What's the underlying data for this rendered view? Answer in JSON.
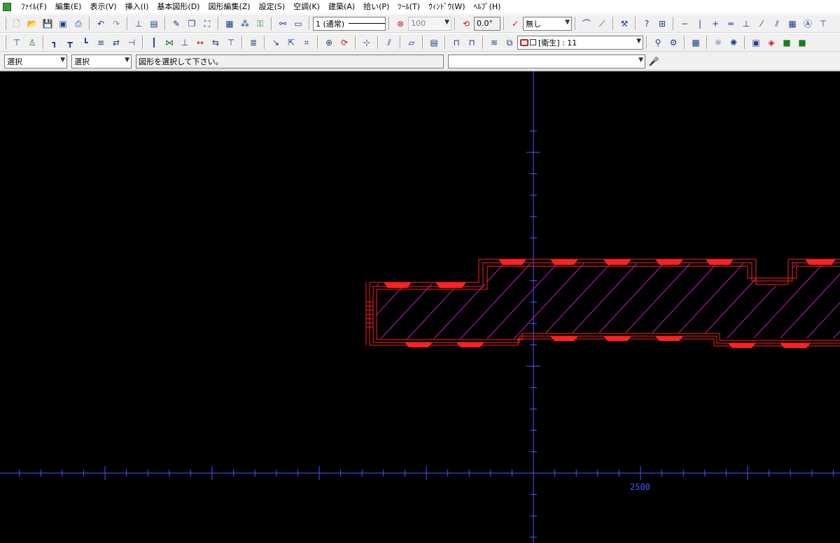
{
  "menu": [
    "ﾌｧｲﾙ(F)",
    "編集(E)",
    "表示(V)",
    "挿入(I)",
    "基本図形(D)",
    "図形編集(Z)",
    "設定(S)",
    "空調(K)",
    "建築(A)",
    "拾い(P)",
    "ﾂｰﾙ(T)",
    "ｳｨﾝﾄﾞｳ(W)",
    "ﾍﾙﾌﾟ(H)"
  ],
  "toolbar1": {
    "linetype_value": "1 (通常)",
    "scale_value": "100",
    "angle_value": "0.0°",
    "arrow_value": "無し"
  },
  "toolbar2": {
    "layer_value": "[衛生] : 11"
  },
  "statusbar": {
    "mode1": "選択",
    "mode2": "選択",
    "message": "図形を選択して下さい。",
    "command_value": ""
  },
  "canvas": {
    "axis_label": "2500",
    "colors": {
      "background": "#000000",
      "axis": "#4a5aff",
      "wall": "#ff2020",
      "hatch": "#c020c0"
    }
  }
}
